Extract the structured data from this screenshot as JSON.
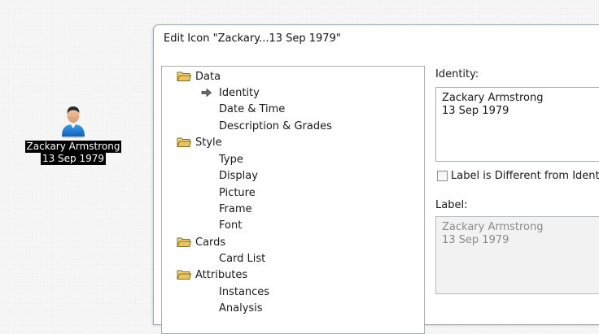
{
  "desktop_icon": {
    "name_line1": "Zackary Armstrong",
    "name_line2": "13 Sep 1979",
    "icon": "person-icon"
  },
  "dialog": {
    "title": "Edit Icon \"Zackary...13 Sep 1979\""
  },
  "tree": {
    "folders": [
      {
        "label": "Data",
        "children": [
          "Identity",
          "Date & Time",
          "Description & Grades"
        ]
      },
      {
        "label": "Style",
        "children": [
          "Type",
          "Display",
          "Picture",
          "Frame",
          "Font"
        ]
      },
      {
        "label": "Cards",
        "children": [
          "Card List"
        ]
      },
      {
        "label": "Attributes",
        "children": [
          "Instances",
          "Analysis"
        ]
      }
    ],
    "selected": "Identity"
  },
  "identity": {
    "label": "Identity:",
    "line1": "Zackary Armstrong",
    "line2": "13 Sep 1979"
  },
  "label_different": {
    "text": "Label is Different from Identity",
    "checked": false
  },
  "label_field": {
    "label": "Label:",
    "line1": "Zackary Armstrong",
    "line2": "13 Sep 1979"
  },
  "colors": {
    "folder": "#e8c468",
    "person_shirt": "#1f7fd6",
    "selection_bg": "#000000"
  }
}
